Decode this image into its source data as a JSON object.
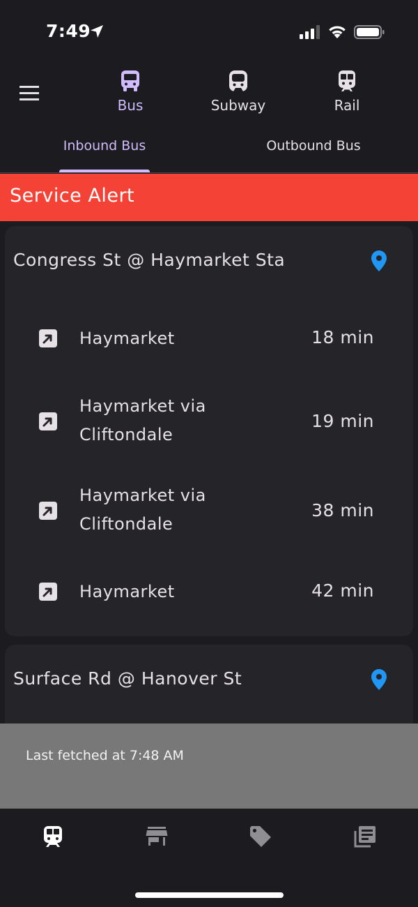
{
  "status_bar": {
    "time": "7:49"
  },
  "header": {
    "menu_icon": "hamburger-menu-icon",
    "mode_tabs": [
      {
        "label": "Bus",
        "icon": "bus-icon",
        "active": true
      },
      {
        "label": "Subway",
        "icon": "subway-icon",
        "active": false
      },
      {
        "label": "Rail",
        "icon": "train-icon",
        "active": false
      }
    ]
  },
  "direction_tabs": [
    {
      "label": "Inbound Bus",
      "active": true
    },
    {
      "label": "Outbound Bus",
      "active": false
    }
  ],
  "alert": {
    "label": "Service Alert",
    "color": "#f44336"
  },
  "stops": [
    {
      "name": "Congress St @ Haymarket Sta",
      "routes": [
        {
          "destination": [
            "Haymarket"
          ],
          "eta": "18 min"
        },
        {
          "destination": [
            "Haymarket via",
            "Cliftondale"
          ],
          "eta": "19 min"
        },
        {
          "destination": [
            "Haymarket via",
            "Cliftondale"
          ],
          "eta": "38 min"
        },
        {
          "destination": [
            "Haymarket"
          ],
          "eta": "42 min"
        }
      ]
    },
    {
      "name": "Surface Rd @ Hanover St",
      "routes": []
    }
  ],
  "snackbar": {
    "text": "Last fetched at 7:48 AM"
  },
  "bottom_nav": [
    {
      "icon": "bus-icon",
      "active": true
    },
    {
      "icon": "store-icon",
      "active": false
    },
    {
      "icon": "tag-icon",
      "active": false
    },
    {
      "icon": "news-icon",
      "active": false
    }
  ],
  "colors": {
    "accent": "#d0bcff",
    "pin": "#2196f3",
    "background": "#1c1b1f",
    "card": "#252429"
  }
}
